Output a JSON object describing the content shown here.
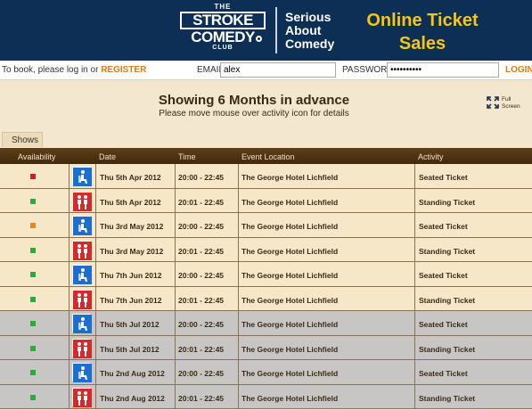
{
  "header": {
    "logo": {
      "the": "THE",
      "line1": "STROKE",
      "line2": "COMEDY",
      "club": "CLUB"
    },
    "tagline": [
      "Serious",
      "About",
      "Comedy"
    ],
    "title_line1": "Online Ticket",
    "title_line2": "Sales"
  },
  "loginbar": {
    "prompt": "To book, please log in or ",
    "register": "REGISTER",
    "email_label": "EMAIL",
    "email_value": "alex",
    "password_label": "PASSWORD",
    "password_value": "••••••••••",
    "login": "LOGIN"
  },
  "main": {
    "heading": "Showing 6 Months in advance",
    "subheading": "Please move mouse over activity icon for details",
    "fullscreen": {
      "line1": "Full",
      "line2": "Screen"
    },
    "tab": "Shows"
  },
  "table": {
    "columns": [
      "Availability",
      "Date",
      "Time",
      "Event Location",
      "Activity"
    ],
    "rows": [
      {
        "availability": "#cc2121",
        "icon": "seated-icon",
        "date": "Thu 5th Apr 2012",
        "time": "20:00 - 22:45",
        "location": "The George Hotel Lichfield",
        "activity": "Seated Ticket",
        "grey": false
      },
      {
        "availability": "#2eaa3a",
        "icon": "standing-icon",
        "date": "Thu 5th Apr 2012",
        "time": "20:01 - 22:45",
        "location": "The George Hotel Lichfield",
        "activity": "Standing Ticket",
        "grey": false
      },
      {
        "availability": "#e5891c",
        "icon": "seated-icon",
        "date": "Thu 3rd May 2012",
        "time": "20:00 - 22:45",
        "location": "The George Hotel Lichfield",
        "activity": "Seated Ticket",
        "grey": false
      },
      {
        "availability": "#2eaa3a",
        "icon": "standing-icon",
        "date": "Thu 3rd May 2012",
        "time": "20:01 - 22:45",
        "location": "The George Hotel Lichfield",
        "activity": "Standing Ticket",
        "grey": false
      },
      {
        "availability": "#2eaa3a",
        "icon": "seated-icon",
        "date": "Thu 7th Jun 2012",
        "time": "20:00 - 22:45",
        "location": "The George Hotel Lichfield",
        "activity": "Seated Ticket",
        "grey": false
      },
      {
        "availability": "#2eaa3a",
        "icon": "standing-icon",
        "date": "Thu 7th Jun 2012",
        "time": "20:01 - 22:45",
        "location": "The George Hotel Lichfield",
        "activity": "Standing Ticket",
        "grey": false
      },
      {
        "availability": "#2eaa3a",
        "icon": "seated-icon",
        "date": "Thu 5th Jul 2012",
        "time": "20:00 - 22:45",
        "location": "The George Hotel Lichfield",
        "activity": "Seated Ticket",
        "grey": true
      },
      {
        "availability": "#2eaa3a",
        "icon": "standing-icon",
        "date": "Thu 5th Jul 2012",
        "time": "20:01 - 22:45",
        "location": "The George Hotel Lichfield",
        "activity": "Standing Ticket",
        "grey": true
      },
      {
        "availability": "#2eaa3a",
        "icon": "seated-icon",
        "date": "Thu 2nd Aug 2012",
        "time": "20:00 - 22:45",
        "location": "The George Hotel Lichfield",
        "activity": "Seated Ticket",
        "grey": true
      },
      {
        "availability": "#2eaa3a",
        "icon": "standing-icon",
        "date": "Thu 2nd Aug 2012",
        "time": "20:01 - 22:45",
        "location": "The George Hotel Lichfield",
        "activity": "Standing Ticket",
        "grey": true
      }
    ]
  },
  "colors": {
    "seated": "#1a6fd0",
    "standing": "#d8282a"
  }
}
